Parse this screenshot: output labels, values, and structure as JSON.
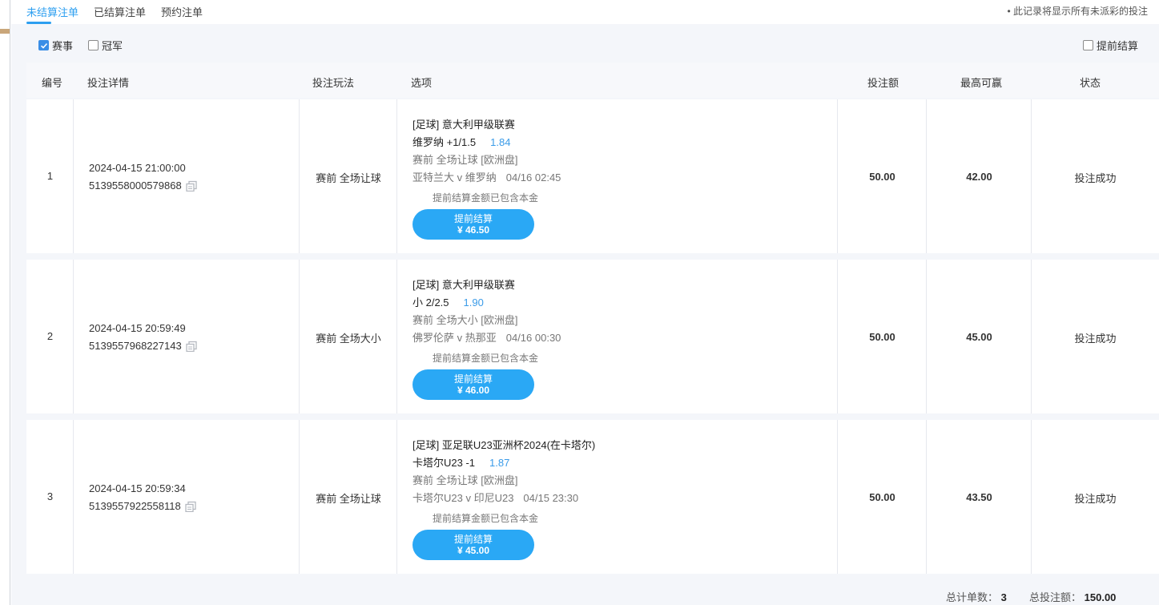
{
  "tabs": [
    {
      "label": "未结算注单",
      "active": true
    },
    {
      "label": "已结算注单",
      "active": false
    },
    {
      "label": "预约注单",
      "active": false
    }
  ],
  "tab_note": "• 此记录将显示所有未派彩的投注",
  "filters": {
    "event": {
      "label": "赛事",
      "checked": true
    },
    "champion": {
      "label": "冠军",
      "checked": false
    },
    "early_settle": {
      "label": "提前结算",
      "checked": false
    }
  },
  "columns": {
    "no": "编号",
    "detail": "投注详情",
    "play": "投注玩法",
    "option": "选项",
    "amount": "投注额",
    "max_win": "最高可赢",
    "status": "状态"
  },
  "rows": [
    {
      "no": "1",
      "datetime": "2024-04-15 21:00:00",
      "order_id": "5139558000579868",
      "play": "赛前   全场让球",
      "league": "[足球] 意大利甲级联赛",
      "pick": "维罗纳 +1/1.5",
      "odds": "1.84",
      "type": "赛前 全场让球 [欧洲盘]",
      "match": "亚特兰大 v 维罗纳",
      "match_time": "04/16 02:45",
      "note": "提前结算金额已包含本金",
      "cashout_label": "提前结算",
      "cashout_amount": "¥ 46.50",
      "amount": "50.00",
      "max_win": "42.00",
      "status": "投注成功"
    },
    {
      "no": "2",
      "datetime": "2024-04-15 20:59:49",
      "order_id": "5139557968227143",
      "play": "赛前   全场大小",
      "league": "[足球] 意大利甲级联赛",
      "pick": "小 2/2.5",
      "odds": "1.90",
      "type": "赛前 全场大小 [欧洲盘]",
      "match": "佛罗伦萨 v 热那亚",
      "match_time": "04/16 00:30",
      "note": "提前结算金额已包含本金",
      "cashout_label": "提前结算",
      "cashout_amount": "¥ 46.00",
      "amount": "50.00",
      "max_win": "45.00",
      "status": "投注成功"
    },
    {
      "no": "3",
      "datetime": "2024-04-15 20:59:34",
      "order_id": "5139557922558118",
      "play": "赛前   全场让球",
      "league": "[足球] 亚足联U23亚洲杯2024(在卡塔尔)",
      "pick": "卡塔尔U23 -1",
      "odds": "1.87",
      "type": "赛前 全场让球 [欧洲盘]",
      "match": "卡塔尔U23 v 印尼U23",
      "match_time": "04/15 23:30",
      "note": "提前结算金额已包含本金",
      "cashout_label": "提前结算",
      "cashout_amount": "¥ 45.00",
      "amount": "50.00",
      "max_win": "43.50",
      "status": "投注成功"
    }
  ],
  "footer": {
    "count_label": "总计单数：",
    "count_value": "3",
    "total_label": "总投注额：",
    "total_value": "150.00"
  },
  "colors": {
    "accent": "#2d9ff0",
    "button": "#2aa8f5",
    "odds": "#3a9be8",
    "background": "#f4f6fa"
  }
}
